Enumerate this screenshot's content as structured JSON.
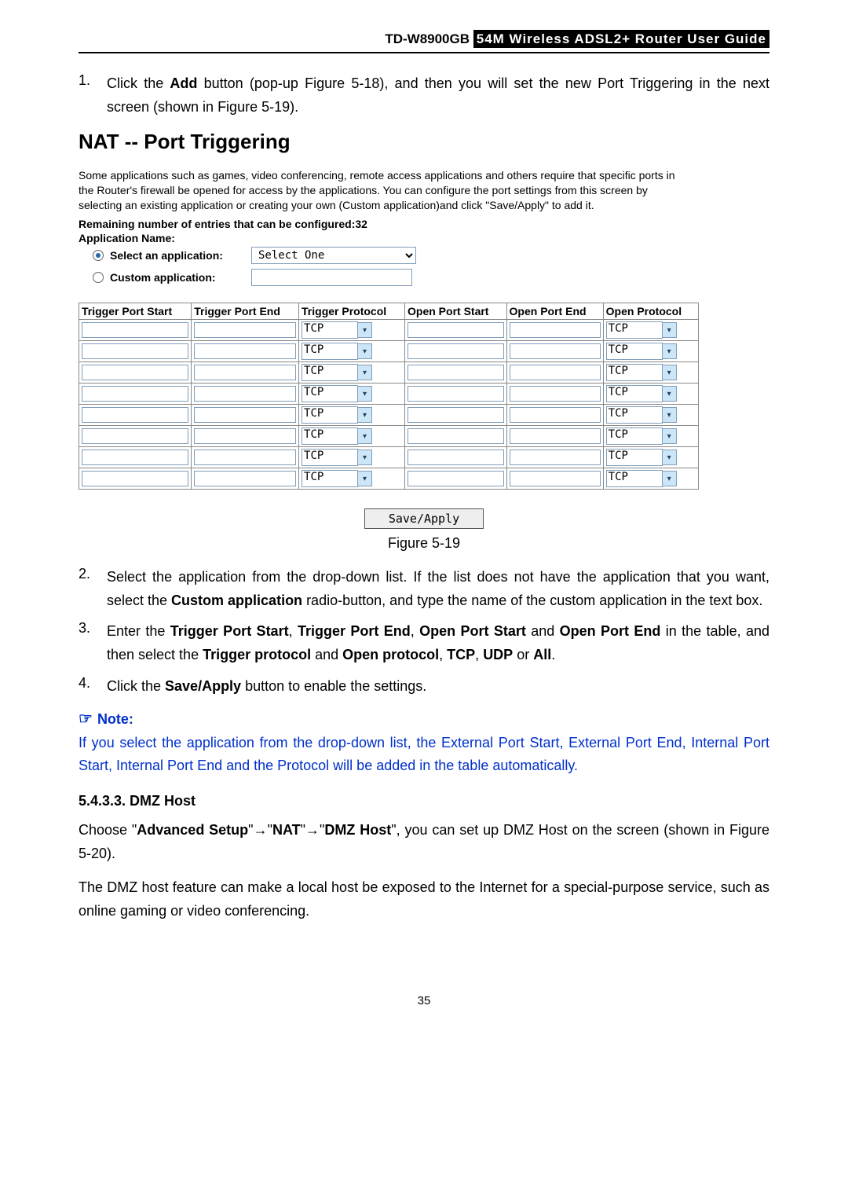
{
  "header": {
    "model": "TD-W8900GB",
    "guide": "54M  Wireless  ADSL2+  Router  User  Guide"
  },
  "step1": {
    "num": "1.",
    "pre": "Click the ",
    "b1": "Add",
    "post1": " button (pop-up Figure 5-18), and then you will set the new Port Triggering in the next screen (shown in Figure 5-19)."
  },
  "screenshot": {
    "title": "NAT -- Port Triggering",
    "desc": "Some applications such as games, video conferencing, remote access applications and others require that specific ports in the Router's firewall be opened for access by the applications. You can configure the port settings from this screen by selecting an existing application or creating your own (Custom application)and click \"Save/Apply\" to add it.",
    "remaining": "Remaining number of entries that can be configured:32",
    "appname_label": "Application Name:",
    "radios": {
      "select_label": "Select an application:",
      "select_value": "Select One",
      "custom_label": "Custom application:",
      "custom_value": ""
    },
    "table": {
      "headers": [
        "Trigger Port Start",
        "Trigger Port End",
        "Trigger Protocol",
        "Open Port Start",
        "Open Port End",
        "Open Protocol"
      ],
      "protocol_value": "TCP",
      "row_count": 8
    },
    "save_apply": "Save/Apply"
  },
  "fig_caption": "Figure 5-19",
  "step2": {
    "num": "2.",
    "t1": "Select the application from the drop-down list. If the list does not have the application that you want, select the ",
    "b1": "Custom application",
    "t2": " radio-button, and type the name of the custom application in the text box."
  },
  "step3": {
    "num": "3.",
    "t1": "Enter the ",
    "b1": "Trigger Port Start",
    "t2": ", ",
    "b2": "Trigger Port End",
    "t3": ", ",
    "b3": "Open Port Start",
    "t4": " and ",
    "b4": "Open Port End",
    "t5": " in the table, and then select the ",
    "b5": "Trigger protocol",
    "t6": " and ",
    "b6": "Open protocol",
    "t7": ", ",
    "b7": "TCP",
    "t8": ", ",
    "b8": "UDP",
    "t9": " or ",
    "b9": "All",
    "t10": "."
  },
  "step4": {
    "num": "4.",
    "t1": "Click the ",
    "b1": "Save/Apply",
    "t2": " button to enable the settings."
  },
  "note": {
    "hand": "☞",
    "label": "Note:",
    "body": "If you select the application from the drop-down list, the External Port Start, External Port End, Internal Port Start, Internal Port End and the Protocol will be added in the table automatically."
  },
  "dmz": {
    "section_num": "5.4.3.3.  DMZ Host",
    "p1_t1": "Choose \"",
    "p1_b1": "Advanced Setup",
    "p1_t2": "\"",
    "arrow": "→",
    "p1_t3": "\"",
    "p1_b2": "NAT",
    "p1_t4": "\"",
    "p1_t5": "\"",
    "p1_b3": "DMZ Host",
    "p1_t6": "\", you can set up DMZ Host on the screen (shown in Figure 5-20).",
    "p2": "The DMZ host feature can make a local host be exposed to the Internet for a special-purpose service, such as online gaming or video conferencing."
  },
  "page_number": "35"
}
